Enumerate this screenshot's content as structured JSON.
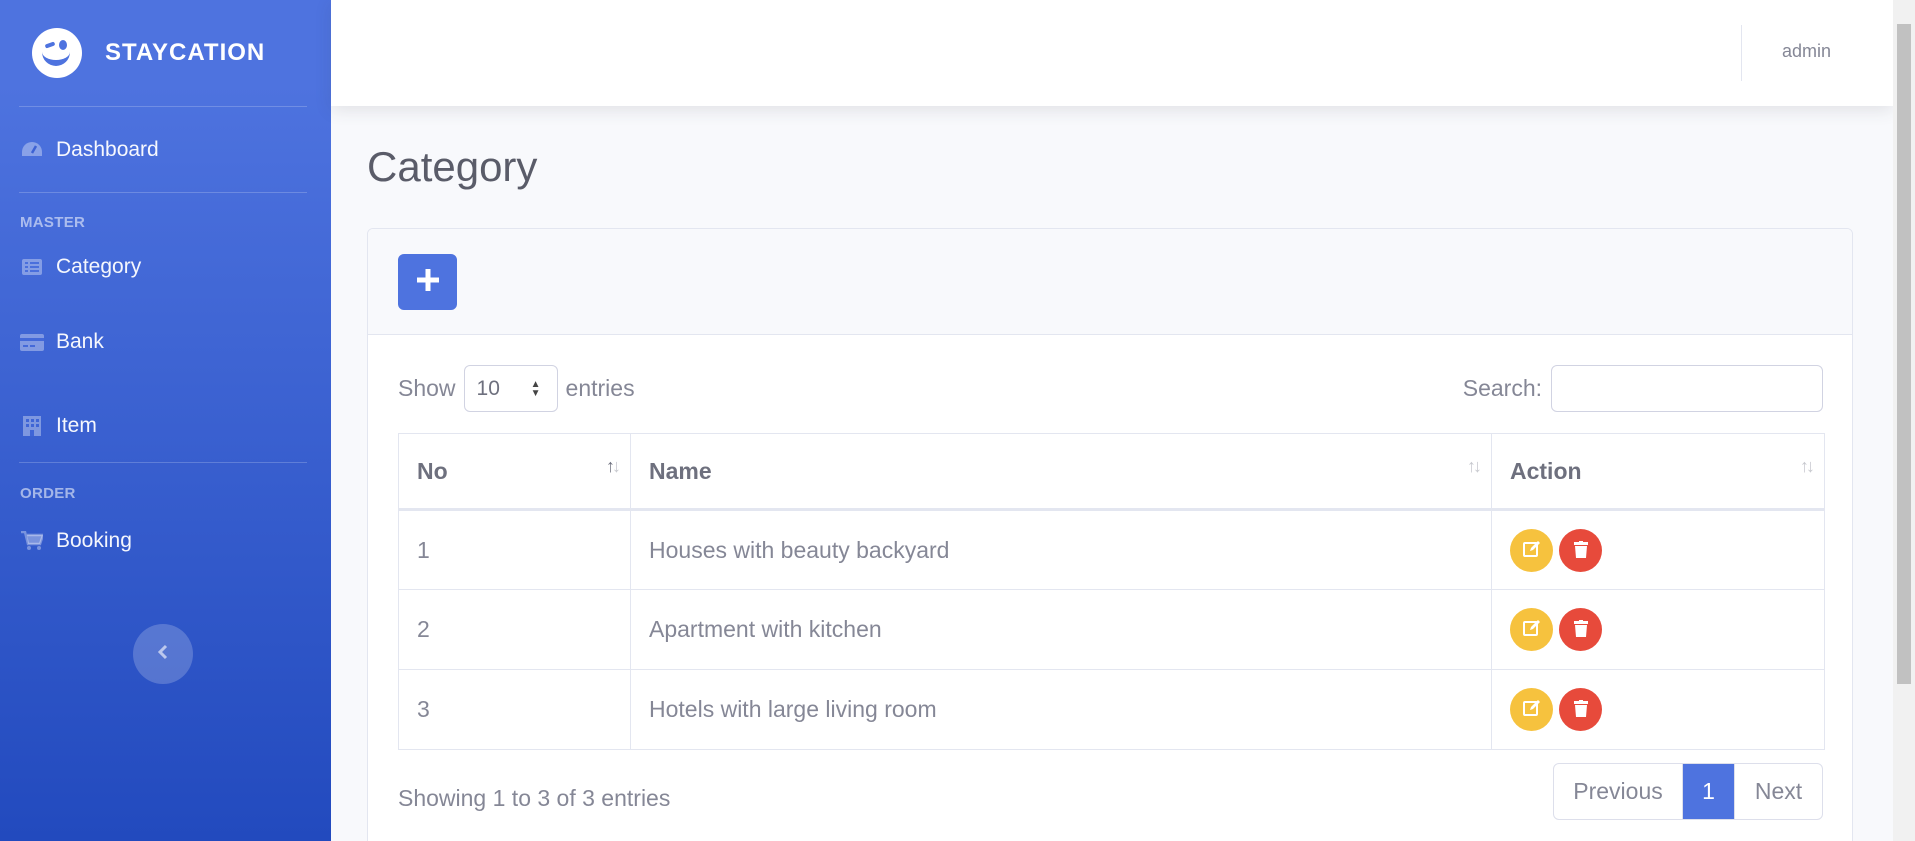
{
  "brand": {
    "name": "STAYCATION"
  },
  "sidebar": {
    "items": [
      {
        "label": "Dashboard",
        "icon": "tachometer-icon"
      },
      {
        "label": "Category",
        "icon": "list-icon"
      },
      {
        "label": "Bank",
        "icon": "credit-card-icon"
      },
      {
        "label": "Item",
        "icon": "building-icon"
      },
      {
        "label": "Booking",
        "icon": "shopping-cart-icon"
      }
    ],
    "headings": {
      "master": "MASTER",
      "order": "ORDER"
    }
  },
  "topbar": {
    "user": "admin"
  },
  "page": {
    "title": "Category"
  },
  "table_controls": {
    "show_label": "Show",
    "entries_value": "10",
    "entries_label": "entries",
    "search_label": "Search:"
  },
  "table": {
    "columns": [
      "No",
      "Name",
      "Action"
    ],
    "rows": [
      {
        "no": "1",
        "name": "Houses with beauty backyard"
      },
      {
        "no": "2",
        "name": "Apartment with kitchen"
      },
      {
        "no": "3",
        "name": "Hotels with large living room"
      }
    ]
  },
  "footer": {
    "info": "Showing 1 to 3 of 3 entries",
    "previous": "Previous",
    "page": "1",
    "next": "Next"
  },
  "colors": {
    "primary": "#4e73df",
    "warning": "#f6c23e",
    "danger": "#e74a3b"
  }
}
